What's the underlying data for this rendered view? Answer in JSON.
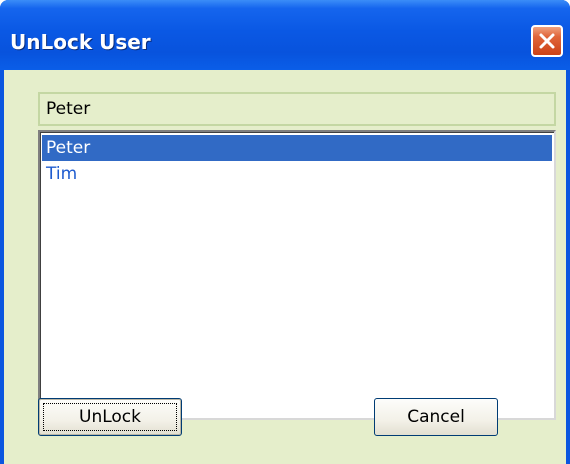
{
  "window": {
    "title": "UnLock User",
    "close_icon": "close-icon",
    "colors": {
      "titlebar": "#0a58e4",
      "client_background": "#e5eecb",
      "close_button": "#e0653a",
      "selection": "#316ac5",
      "item_text": "#1f5ccf"
    }
  },
  "form": {
    "name_value": "Peter"
  },
  "users": {
    "items": [
      {
        "label": "Peter",
        "selected": true
      },
      {
        "label": "Tim",
        "selected": false
      }
    ]
  },
  "buttons": {
    "unlock_label": "UnLock",
    "cancel_label": "Cancel"
  }
}
